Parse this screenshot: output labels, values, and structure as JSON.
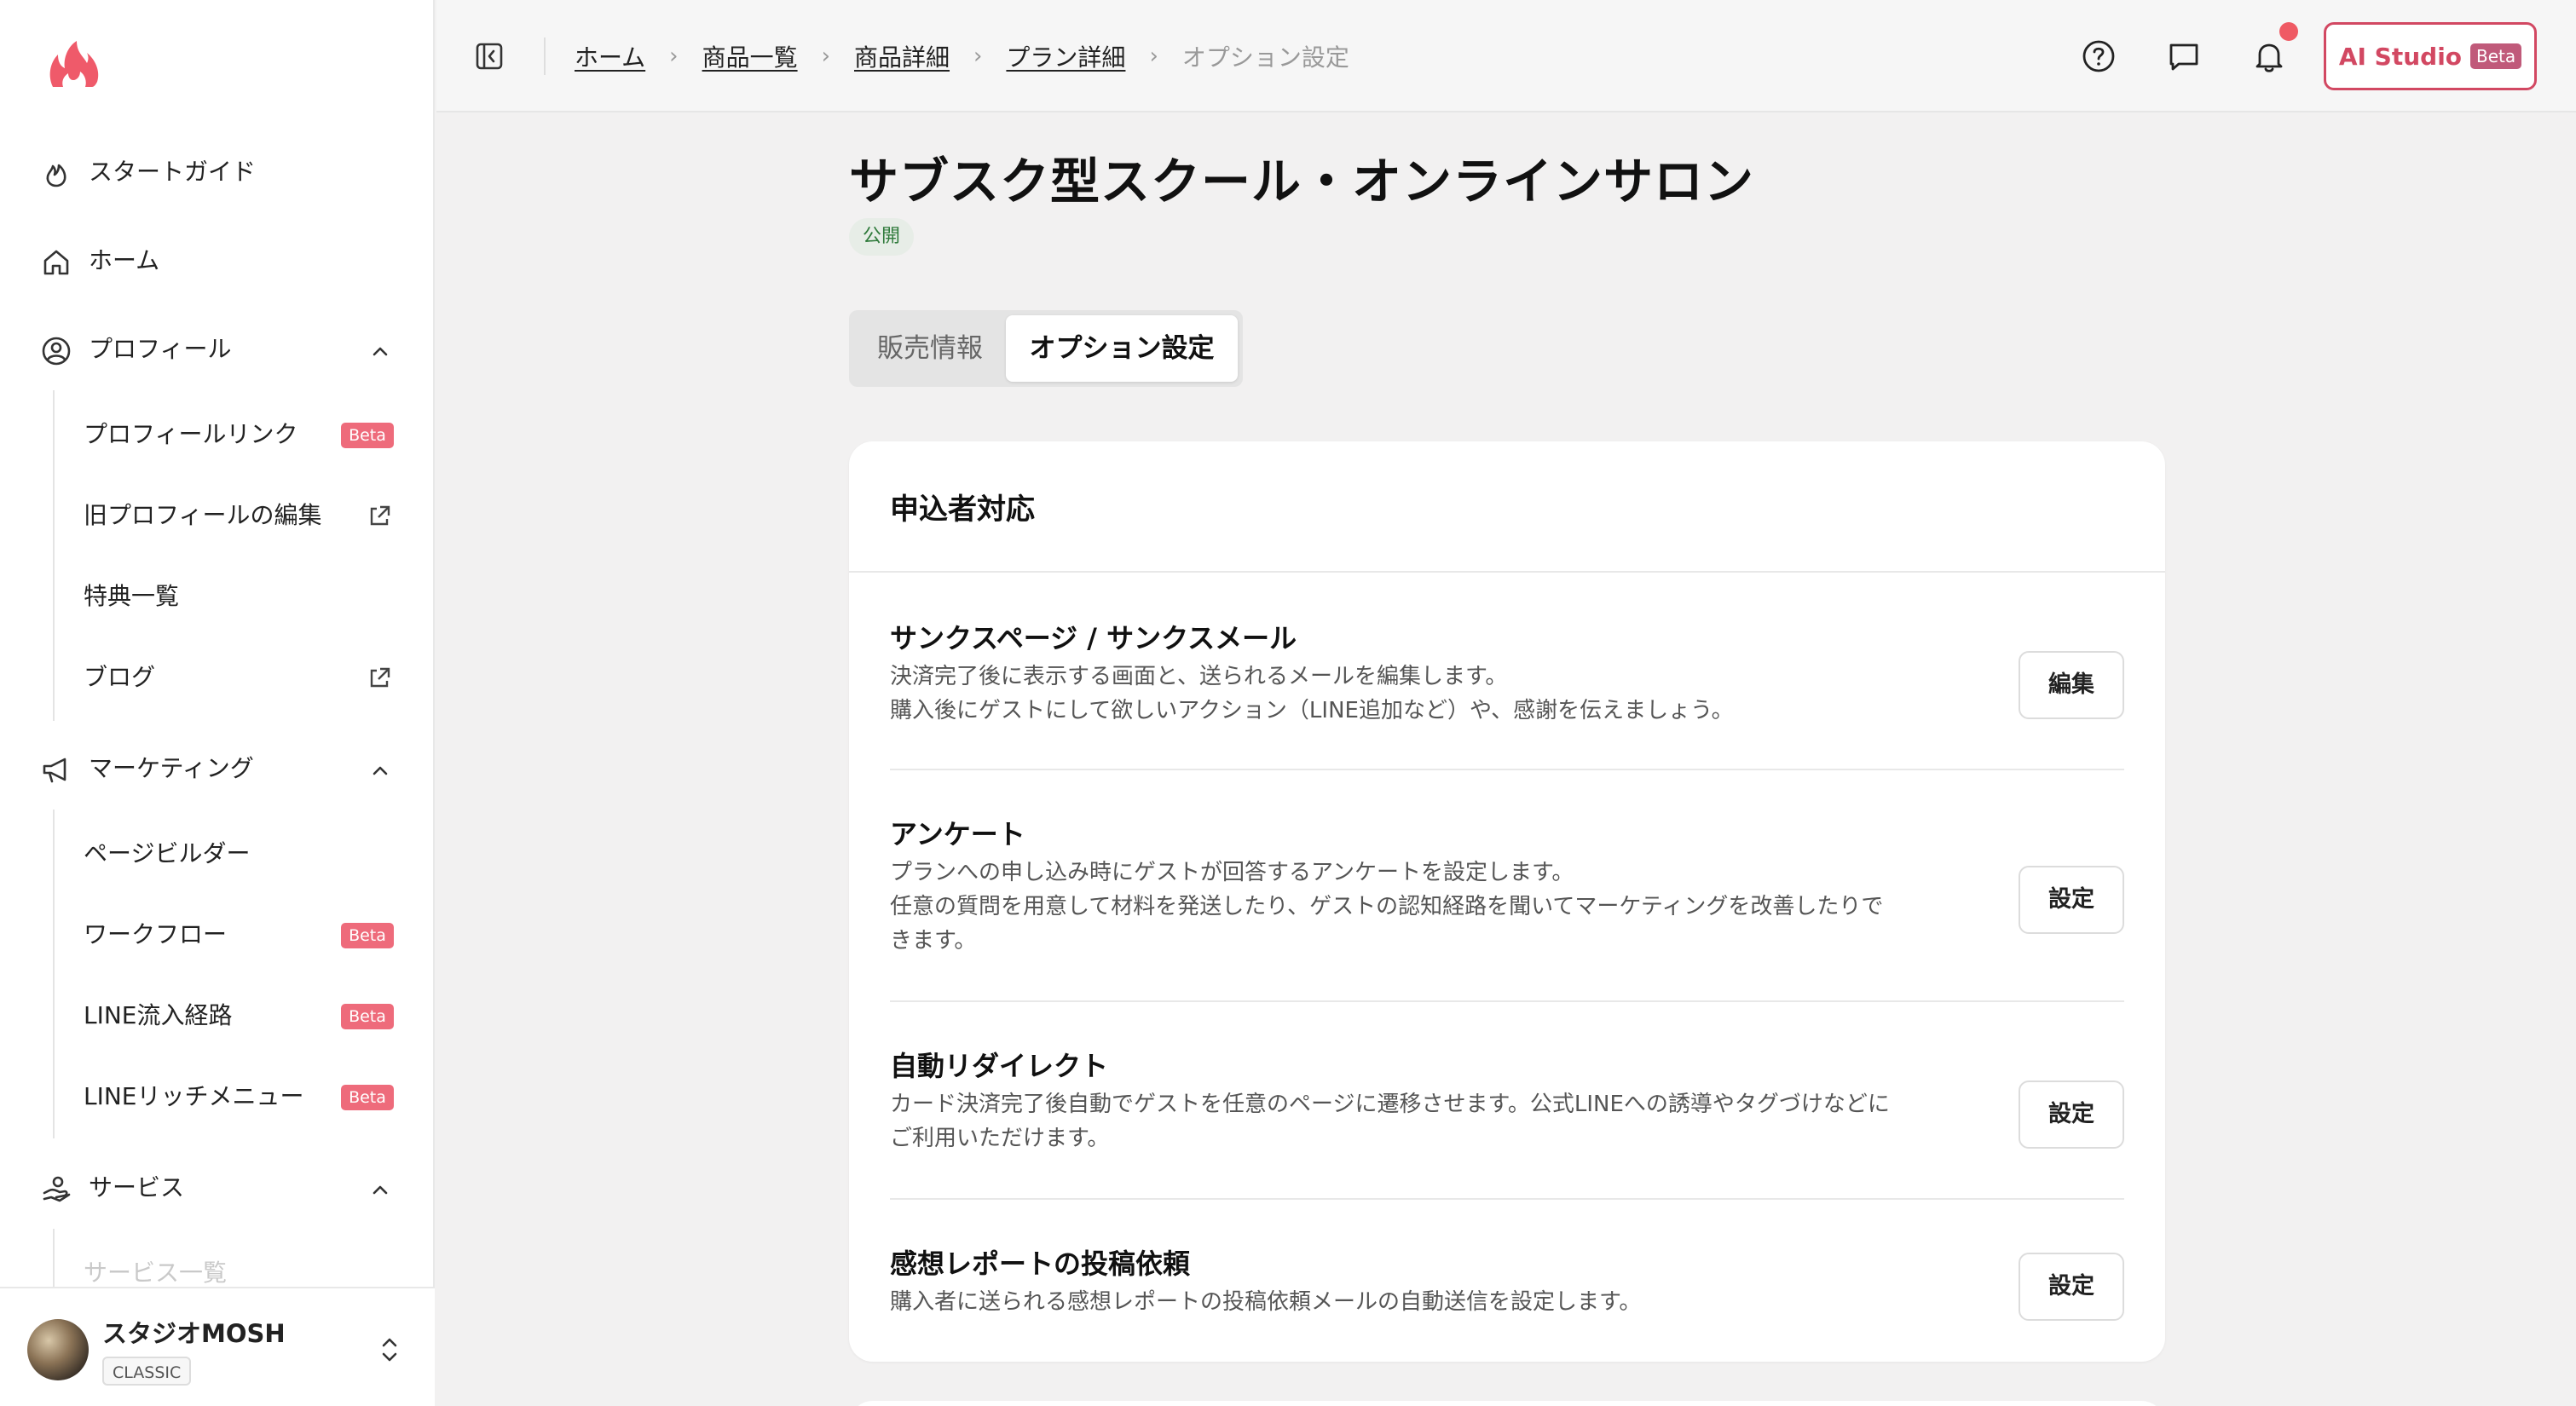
{
  "sidebar": {
    "nav": {
      "start_guide": "スタートガイド",
      "home": "ホーム",
      "profile": "プロフィール",
      "marketing": "マーケティング",
      "service": "サービス"
    },
    "profile_items": [
      {
        "label": "プロフィールリンク",
        "badge": "Beta"
      },
      {
        "label": "旧プロフィールの編集",
        "icon": "external-link-icon"
      },
      {
        "label": "特典一覧"
      },
      {
        "label": "ブログ",
        "icon": "external-link-icon"
      }
    ],
    "marketing_items": [
      {
        "label": "ページビルダー"
      },
      {
        "label": "ワークフロー",
        "badge": "Beta"
      },
      {
        "label": "LINE流入経路",
        "badge": "Beta"
      },
      {
        "label": "LINEリッチメニュー",
        "badge": "Beta"
      }
    ],
    "service_items": [
      {
        "label": "サービス一覧"
      }
    ],
    "user": {
      "name": "スタジオMOSH",
      "plan": "CLASSIC"
    }
  },
  "header": {
    "breadcrumb": [
      "ホーム",
      "商品一覧",
      "商品詳細",
      "プラン詳細",
      "オプション設定"
    ],
    "separator": "›",
    "ai_button": {
      "label": "AI Studio",
      "badge": "Beta"
    },
    "accent_color": "#d24862"
  },
  "main": {
    "title": "サブスク型スクール・オンラインサロン",
    "status": "公開",
    "tabs": [
      "販売情報",
      "オプション設定"
    ],
    "active_tab": "オプション設定",
    "section_title": "申込者対応",
    "options": [
      {
        "title": "サンクスページ / サンクスメール",
        "desc": [
          "決済完了後に表示する画面と、送られるメールを編集します。",
          "購入後にゲストにして欲しいアクション（LINE追加など）や、感謝を伝えましょう。"
        ],
        "button": "編集"
      },
      {
        "title": "アンケート",
        "desc": [
          "プランへの申し込み時にゲストが回答するアンケートを設定します。",
          "任意の質問を用意して材料を発送したり、ゲストの認知経路を聞いてマーケティングを改善したりで",
          "きます。"
        ],
        "button": "設定"
      },
      {
        "title": "自動リダイレクト",
        "desc": [
          "カード決済完了後自動でゲストを任意のページに遷移させます。公式LINEへの誘導やタグづけなどに",
          "ご利用いただけます。"
        ],
        "button": "設定"
      },
      {
        "title": "感想レポートの投稿依頼",
        "desc": [
          "購入者に送られる感想レポートの投稿依頼メールの自動送信を設定します。"
        ],
        "button": "設定"
      }
    ]
  }
}
